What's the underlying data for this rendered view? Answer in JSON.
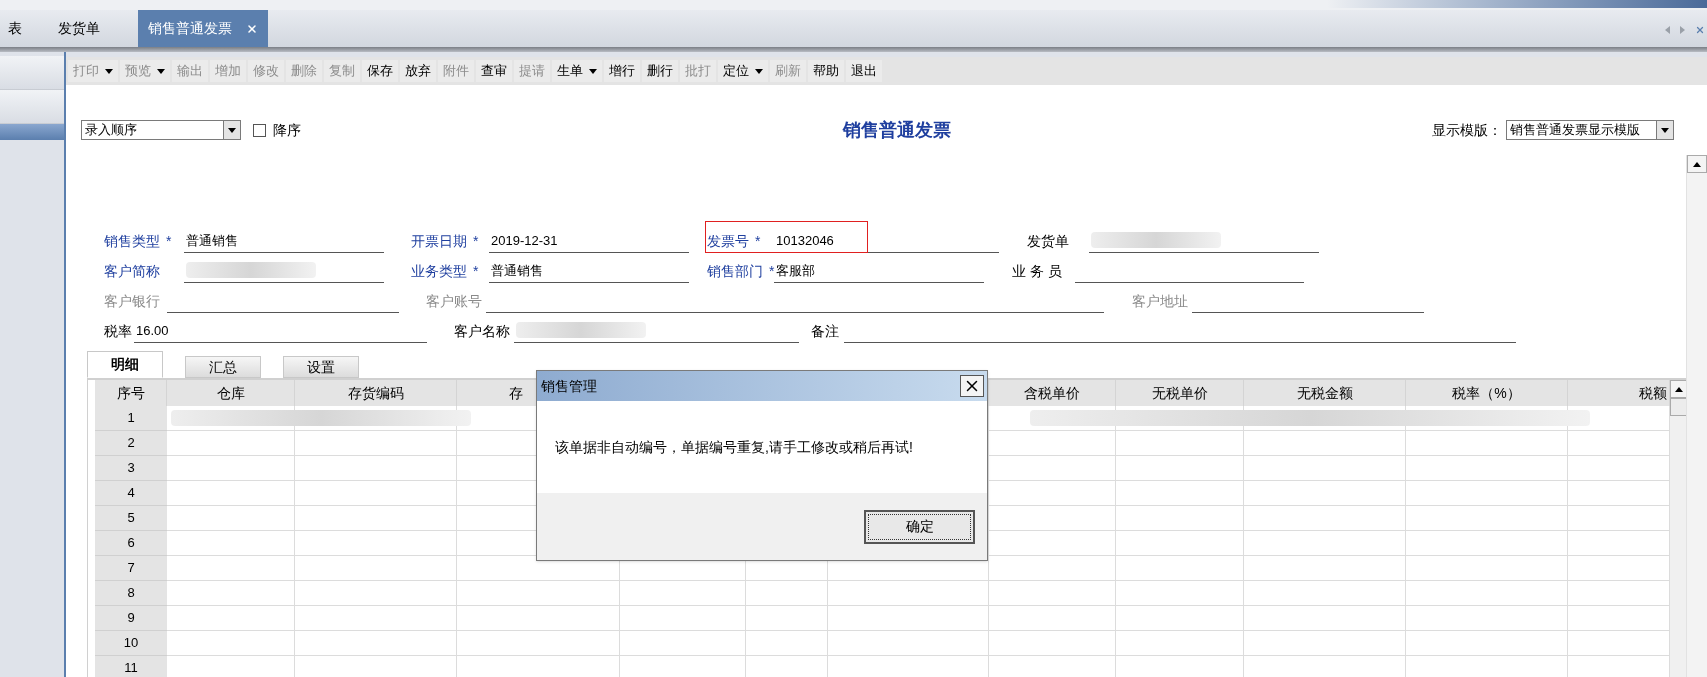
{
  "tabs": [
    {
      "label": "表",
      "selected": false,
      "closable": false
    },
    {
      "label": "发货单",
      "selected": false,
      "closable": false
    },
    {
      "label": "销售普通发票",
      "selected": true,
      "closable": true
    }
  ],
  "sidebar": {
    "items": [
      {
        "selected": false
      },
      {
        "selected": false
      },
      {
        "selected": true
      }
    ]
  },
  "toolbar": [
    {
      "label": "打印",
      "disabled": true,
      "dropdown": true
    },
    {
      "label": "预览",
      "disabled": true,
      "dropdown": true
    },
    {
      "label": "输出",
      "disabled": true,
      "dropdown": false
    },
    {
      "label": "增加",
      "disabled": true,
      "dropdown": false
    },
    {
      "label": "修改",
      "disabled": true,
      "dropdown": false
    },
    {
      "label": "删除",
      "disabled": true,
      "dropdown": false
    },
    {
      "label": "复制",
      "disabled": true,
      "dropdown": false
    },
    {
      "label": "保存",
      "disabled": false,
      "dropdown": false
    },
    {
      "label": "放弃",
      "disabled": false,
      "dropdown": false
    },
    {
      "label": "附件",
      "disabled": true,
      "dropdown": false
    },
    {
      "label": "查审",
      "disabled": false,
      "dropdown": false
    },
    {
      "label": "提请",
      "disabled": true,
      "dropdown": false
    },
    {
      "label": "生单",
      "disabled": false,
      "dropdown": true
    },
    {
      "label": "增行",
      "disabled": false,
      "dropdown": false
    },
    {
      "label": "删行",
      "disabled": false,
      "dropdown": false
    },
    {
      "label": "批打",
      "disabled": true,
      "dropdown": false
    },
    {
      "label": "定位",
      "disabled": false,
      "dropdown": true
    },
    {
      "label": "刷新",
      "disabled": true,
      "dropdown": false
    },
    {
      "label": "帮助",
      "disabled": false,
      "dropdown": false
    },
    {
      "label": "退出",
      "disabled": false,
      "dropdown": false
    }
  ],
  "sort": {
    "value": "录入顺序",
    "descending_label": "降序",
    "descending": false
  },
  "title": "销售普通发票",
  "template": {
    "label": "显示模版：",
    "value": "销售普通发票显示模版"
  },
  "fields": [
    [
      {
        "label": "销售类型",
        "kind": "required",
        "marker": "*",
        "value": "普通销售"
      },
      {
        "label": "开票日期",
        "kind": "required",
        "marker": "*",
        "value": "2019-12-31"
      },
      {
        "label": "发票号",
        "kind": "required",
        "marker": "*",
        "value": "10132046",
        "highlighted": true
      },
      {
        "label": "发货单",
        "kind": "normal",
        "value_hidden": true
      }
    ],
    [
      {
        "label": "客户简称",
        "kind": "required",
        "value_hidden": true
      },
      {
        "label": "业务类型",
        "kind": "required",
        "marker": "*",
        "value": "普通销售"
      },
      {
        "label": "销售部门",
        "kind": "required",
        "marker": "*",
        "value": "客服部"
      },
      {
        "label": "业 务 员",
        "kind": "normal"
      }
    ],
    [
      {
        "label": "客户银行",
        "kind": "disabled"
      },
      {
        "label": "客户账号",
        "kind": "disabled"
      },
      {
        "label": "客户地址",
        "kind": "disabled"
      }
    ],
    [
      {
        "label": "税率",
        "kind": "normal",
        "value": "16.00"
      },
      {
        "label": "客户名称",
        "kind": "normal",
        "value_hidden": true
      },
      {
        "label": "备注",
        "kind": "normal"
      }
    ]
  ],
  "detail_tabs": [
    {
      "label": "明细",
      "selected": true
    },
    {
      "label": "汇总",
      "selected": false
    },
    {
      "label": "设置",
      "selected": false
    }
  ],
  "table": {
    "columns": [
      "序号",
      "仓库",
      "存货编码",
      "存",
      "含税单价",
      "无税单价",
      "无税金额",
      "税率（%）",
      "税额"
    ],
    "rows": [
      {
        "number": "1",
        "value_hidden": true
      },
      {
        "number": "2"
      },
      {
        "number": "3"
      },
      {
        "number": "4"
      },
      {
        "number": "5"
      },
      {
        "number": "6"
      },
      {
        "number": "7"
      },
      {
        "number": "8"
      },
      {
        "number": "9"
      },
      {
        "number": "10"
      },
      {
        "number": "11"
      }
    ]
  },
  "dialog": {
    "title": "销售管理",
    "message": "该单据非自动编号，单据编号重复,请手工修改或稍后再试!",
    "button": "确定"
  }
}
